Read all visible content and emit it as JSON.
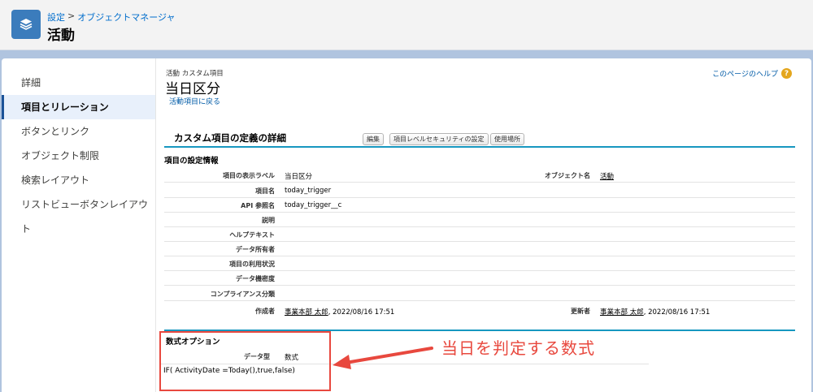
{
  "header": {
    "breadcrumb": {
      "setup": "設定",
      "sep": ">",
      "object_manager": "オブジェクトマネージャ"
    },
    "title": "活動",
    "icon": "layers-icon"
  },
  "sidebar": {
    "items": [
      {
        "label": "詳細",
        "active": false
      },
      {
        "label": "項目とリレーション",
        "active": true
      },
      {
        "label": "ボタンとリンク",
        "active": false
      },
      {
        "label": "オブジェクト制限",
        "active": false
      },
      {
        "label": "検索レイアウト",
        "active": false
      },
      {
        "label": "リストビューボタンレイアウト",
        "active": false
      }
    ]
  },
  "content": {
    "subtitle": "活動 カスタム項目",
    "field_title": "当日区分",
    "back_link": "活動項目に戻る",
    "help_link": "このページのヘルプ",
    "help_symbol": "?",
    "detail_title": "カスタム項目の定義の詳細",
    "buttons": {
      "edit": "編集",
      "security": "項目レベルセキュリティの設定",
      "usage": "使用場所"
    },
    "section_info": "項目の設定情報",
    "rows": [
      {
        "label": "項目の表示ラベル",
        "value": "当日区分",
        "label2": "オブジェクト名",
        "value2": "活動"
      },
      {
        "label": "項目名",
        "value": "today_trigger"
      },
      {
        "label": "API 参照名",
        "value": "today_trigger__c"
      },
      {
        "label": "説明",
        "value": ""
      },
      {
        "label": "ヘルプテキスト",
        "value": ""
      },
      {
        "label": "データ所有者",
        "value": ""
      },
      {
        "label": "項目の利用状況",
        "value": ""
      },
      {
        "label": "データ機密度",
        "value": ""
      },
      {
        "label": "コンプライアンス分類",
        "value": ""
      },
      {
        "label": "作成者",
        "value_user": "事業本部 太郎",
        "value_date": ", 2022/08/16 17:51",
        "label2": "更新者",
        "value2_user": "事業本部 太郎",
        "value2_date": ", 2022/08/16 17:51"
      }
    ],
    "formula": {
      "section": "数式オプション",
      "datatype_label": "データ型",
      "datatype_value": "数式",
      "expression": "IF( ActivityDate =Today(),true,false)"
    }
  },
  "annotation": {
    "text": "当日を判定する数式",
    "color": "#e8483e"
  }
}
